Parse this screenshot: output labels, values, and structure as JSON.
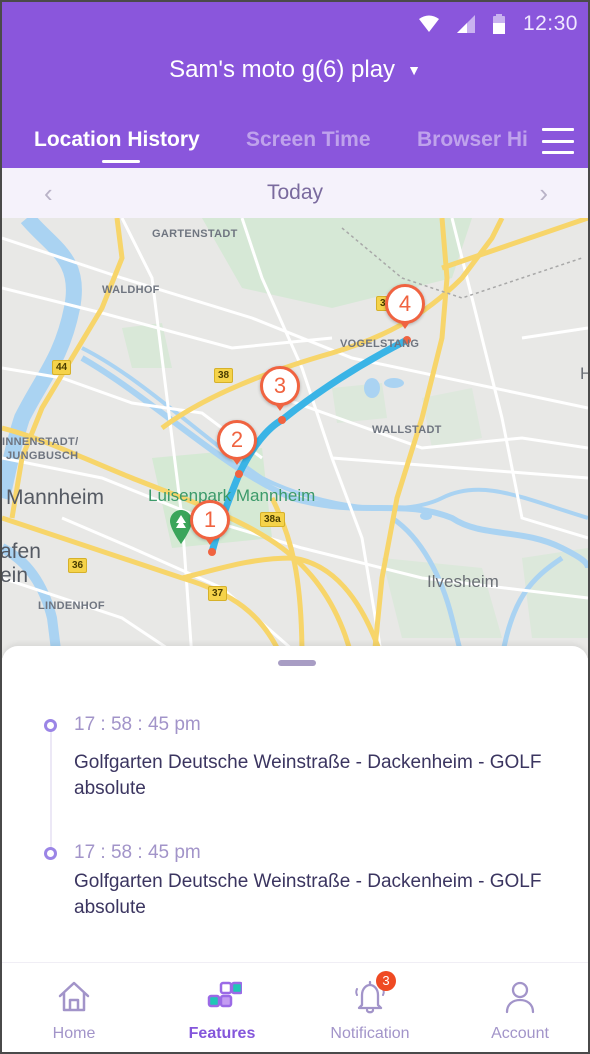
{
  "status_bar": {
    "time": "12:30",
    "icons": [
      "wifi-icon",
      "signal-icon",
      "battery-icon"
    ]
  },
  "header": {
    "device_name": "Sam's moto g(6) play",
    "device_caret": "▼",
    "tabs": [
      {
        "label": "Location History",
        "active": true
      },
      {
        "label": "Screen Time",
        "active": false
      },
      {
        "label": "Browser History",
        "active": false
      }
    ],
    "menu_icon": "hamburger-menu-icon"
  },
  "datebar": {
    "label": "Today",
    "prev": "‹",
    "next": "›"
  },
  "map": {
    "labels": {
      "gartenstadt": "GARTENSTADT",
      "waldhof": "WALDHOF",
      "vogelstang": "VOGELSTANG",
      "wallstadt": "WALLSTADT",
      "innenstadt": "INNENSTADT/",
      "jungbusch": "JUNGBUSCH",
      "mannheim": "Mannheim",
      "luisenpark": "Luisenpark Mannheim",
      "hafen": "afen",
      "ein": "ein",
      "lindenhof": "LINDENHOF",
      "ilvesheim": "Ilvesheim",
      "h": "H"
    },
    "road_shields": [
      "44",
      "38",
      "38a",
      "36",
      "37",
      "38"
    ],
    "markers": [
      "1",
      "2",
      "3",
      "4"
    ],
    "route_color": "#3ab4e6",
    "marker_color": "#f06340"
  },
  "timeline": {
    "entries": [
      {
        "time": "17 : 58 : 45 pm",
        "place": "Golfgarten Deutsche Weinstraße - Dackenheim - GOLF absolute"
      },
      {
        "time": "17 : 58 : 45 pm",
        "place": "Golfgarten Deutsche Weinstraße - Dackenheim - GOLF absolute"
      }
    ]
  },
  "bottom_nav": {
    "items": [
      {
        "label": "Home",
        "icon": "home-icon",
        "active": false
      },
      {
        "label": "Features",
        "icon": "features-grid-icon",
        "active": true
      },
      {
        "label": "Notification",
        "icon": "bell-icon",
        "active": false,
        "badge": "3"
      },
      {
        "label": "Account",
        "icon": "user-icon",
        "active": false
      }
    ]
  },
  "colors": {
    "brand": "#8a56dc",
    "accent_teal": "#1fc7b6",
    "badge": "#ef4a23"
  }
}
